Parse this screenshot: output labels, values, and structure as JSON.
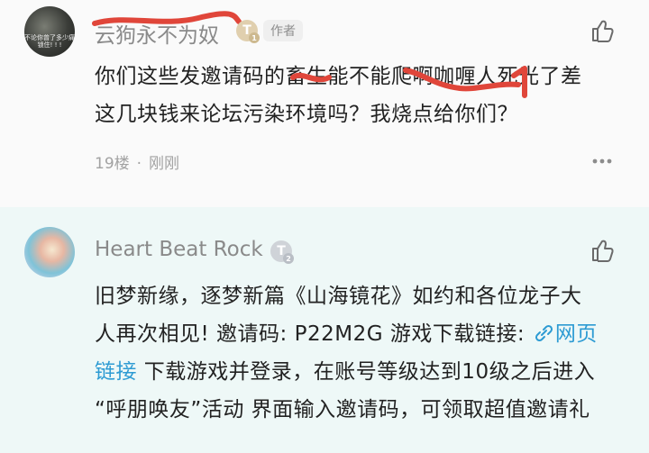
{
  "comments": [
    {
      "username": "云狗永不为奴",
      "avatar_caption": "不论你曾了多少痛 锁住! ! !",
      "level_badge": "T",
      "level_sub": "1",
      "author_tag": "作者",
      "text_lines": [
        "你们这些发邀请码的畜生能不能爬啊咖喱人死光了差",
        "这几块钱来论坛污染环境吗？我烧点给你们？"
      ],
      "floor": "19楼",
      "time": "刚刚"
    },
    {
      "username": "Heart Beat Rock",
      "level_badge": "T",
      "level_sub": "2",
      "line1": "旧梦新缘，逐梦新篇《山海镜花》如约和各位龙子大",
      "line2_text": "人再次相见! 邀请码: P22M2G 游戏下载链接: ",
      "link_label_part1": "网页",
      "link_label_part2": "链接",
      "line3_rest": " 下载游戏并登录，在账号等级达到10级之后进入",
      "line4": "“呼朋唤友”活动 界面输入邀请码，可领取超值邀请礼"
    }
  ],
  "colors": {
    "link": "#2d9bd3",
    "scribble": "#e0463a",
    "highlight_bg": "#eef8f7"
  },
  "icons": [
    "thumb-up-icon",
    "more-icon",
    "link-icon"
  ]
}
